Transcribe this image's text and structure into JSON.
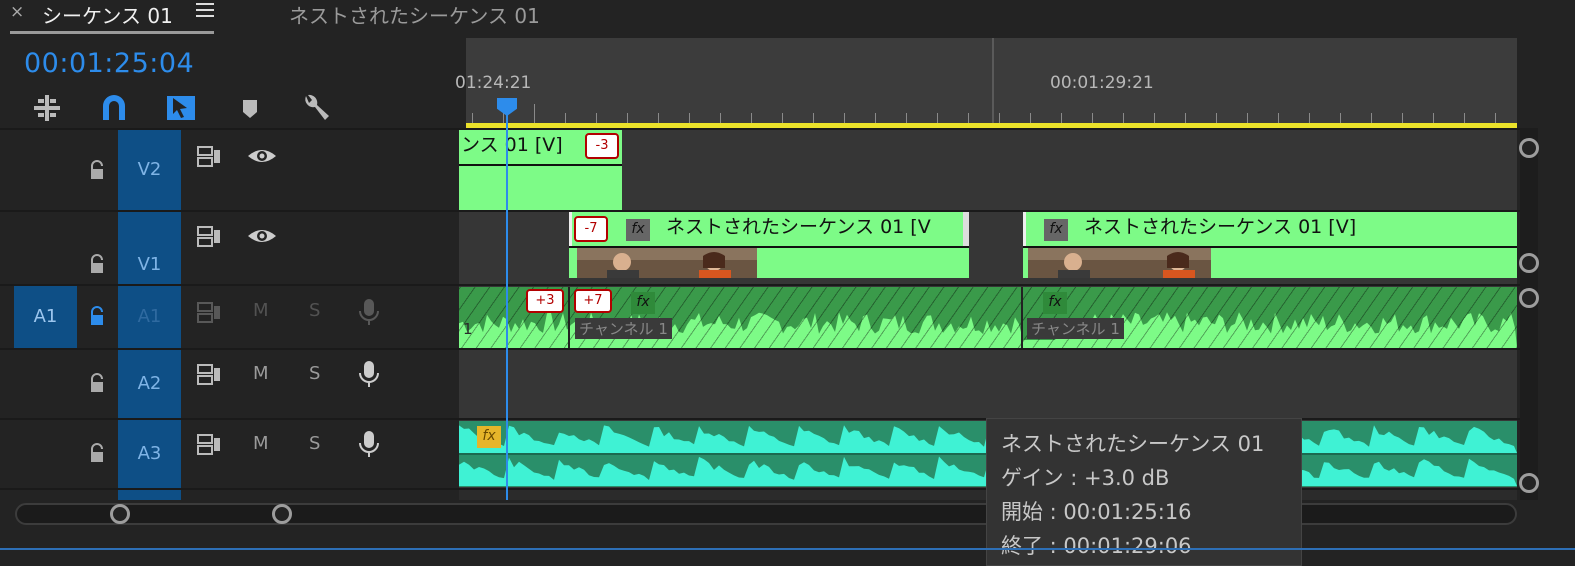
{
  "tabs": {
    "close": "×",
    "active": "シーケンス 01",
    "inactive": "ネストされたシーケンス 01"
  },
  "timecode": "00:01:25:04",
  "toolbar": [
    "insert-tracks-icon",
    "snap-magnet-icon",
    "linked-selection-icon",
    "add-marker-icon",
    "timeline-settings-wrench-icon"
  ],
  "ruler": {
    "label_start": "01:24:21",
    "label_mid": "00:01:29:21"
  },
  "tracks": [
    {
      "name": "V2",
      "type": "video"
    },
    {
      "name": "V1",
      "type": "video",
      "source_patch": ""
    },
    {
      "name": "A1",
      "type": "audio",
      "source_patch": "A1",
      "mute": "M",
      "solo": "S"
    },
    {
      "name": "A2",
      "type": "audio",
      "mute": "M",
      "solo": "S"
    },
    {
      "name": "A3",
      "type": "audio",
      "mute": "M",
      "solo": "S"
    }
  ],
  "clips": {
    "v2_title": "ンス 01 [V]",
    "v2_badge": "-3",
    "v1a_title": "ネストされたシーケンス 01 [V",
    "v1a_badge": "-7",
    "v1b_title": "ネストされたシーケンス 01 [V]",
    "fx": "fx",
    "a1_badge1": "+3",
    "a1_badge2": "+7",
    "a1_label_a": "1",
    "a1_label_b": "チャンネル 1",
    "a1_label_c": "チャンネル 1"
  },
  "tooltip": {
    "title": "ネストされたシーケンス 01",
    "gain": "ゲイン : +3.0 dB",
    "start": "開始 : 00:01:25:16",
    "end": "終了 : 00:01:29:06"
  },
  "colors": {
    "accent": "#2d8ceb",
    "video_clip": "#7dfb87",
    "audio_clip_a1": "#3a9a4a",
    "audio_clip_a3": "#3ff2d4",
    "work_area": "#ebe22a"
  }
}
